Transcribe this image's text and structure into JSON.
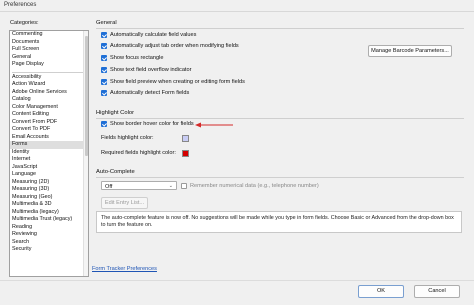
{
  "window": {
    "title": "Preferences"
  },
  "categories": {
    "label": "Categories:",
    "top_items": [
      "Commenting",
      "Documents",
      "Full Screen",
      "General",
      "Page Display"
    ],
    "items": [
      "Accessibility",
      "Action Wizard",
      "Adobe Online Services",
      "Catalog",
      "Color Management",
      "Content Editing",
      "Convert From PDF",
      "Convert To PDF",
      "Email Accounts",
      "Forms",
      "Identity",
      "Internet",
      "JavaScript",
      "Language",
      "Measuring (2D)",
      "Measuring (3D)",
      "Measuring (Geo)",
      "Multimedia & 3D",
      "Multimedia (legacy)",
      "Multimedia Trust (legacy)",
      "Reading",
      "Reviewing",
      "Search",
      "Security"
    ],
    "selected": "Forms"
  },
  "general": {
    "title": "General",
    "options": [
      {
        "label": "Automatically calculate field values",
        "checked": true
      },
      {
        "label": "Automatically adjust tab order when modifying fields",
        "checked": true
      },
      {
        "label": "Show focus rectangle",
        "checked": true
      },
      {
        "label": "Show text field overflow indicator",
        "checked": true
      },
      {
        "label": "Show field preview when creating or editing form fields",
        "checked": true
      },
      {
        "label": "Automatically detect Form fields",
        "checked": true
      }
    ],
    "manage_barcode_button": "Manage Barcode Parameters..."
  },
  "highlight": {
    "title": "Highlight Color",
    "show_border_label": "Show border hover color for fields",
    "show_border_checked": true,
    "fields_color_label": "Fields highlight color:",
    "fields_color": "#c9cdf5",
    "required_color_label": "Required fields highlight color:",
    "required_color": "#d40000",
    "annotation_arrow_color": "#d42a2a"
  },
  "autocomplete": {
    "title": "Auto-Complete",
    "select_value": "Off",
    "remember_label": "Remember numerical data (e.g., telephone number)",
    "remember_checked": false,
    "edit_button": "Edit Entry List...",
    "info_text": "The auto-complete feature is now off. No suggestions will be made while you type in form fields. Choose Basic or Advanced from the drop-down box to turn the feature on."
  },
  "footer": {
    "link": "Form Tracker Preferences",
    "ok_button": "OK",
    "cancel_button": "Cancel"
  }
}
